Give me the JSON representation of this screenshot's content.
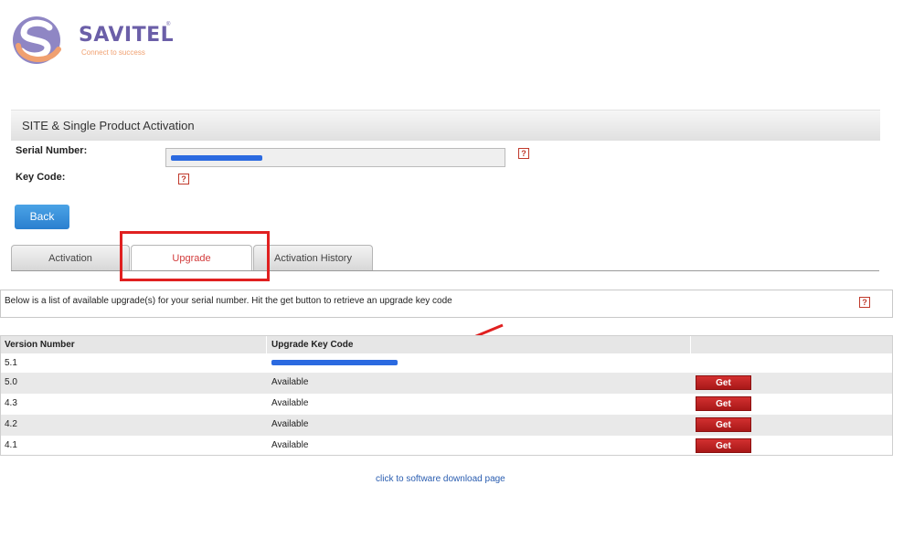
{
  "brand": {
    "name": "SAVITEL",
    "tm": "®",
    "tagline": "Connect to success"
  },
  "panel": {
    "title": "SITE & Single Product Activation"
  },
  "form": {
    "serial_label": "Serial Number:",
    "key_label": "Key Code:",
    "help_glyph": "?"
  },
  "back_button": "Back",
  "tabs": [
    {
      "label": "Activation",
      "active": false
    },
    {
      "label": "Upgrade",
      "active": true
    },
    {
      "label": "Activation History",
      "active": false
    }
  ],
  "info": {
    "text": "Below is a list of available upgrade(s) for your serial number. Hit the get button to retrieve an upgrade key code"
  },
  "table": {
    "headers": [
      "Version Number",
      "Upgrade Key Code",
      ""
    ],
    "rows": [
      {
        "version": "5.1",
        "key": "",
        "has_get": false
      },
      {
        "version": "5.0",
        "key": "Available",
        "has_get": true
      },
      {
        "version": "4.3",
        "key": "Available",
        "has_get": true
      },
      {
        "version": "4.2",
        "key": "Available",
        "has_get": true
      },
      {
        "version": "4.1",
        "key": "Available",
        "has_get": true
      }
    ],
    "get_label": "Get"
  },
  "download_link": "click to software download page",
  "colors": {
    "brand_purple": "#6b5fa8",
    "brand_orange": "#f0a070",
    "accent_red": "#e02020",
    "link_blue": "#2a5db0",
    "button_blue": "#2a7fcf"
  }
}
